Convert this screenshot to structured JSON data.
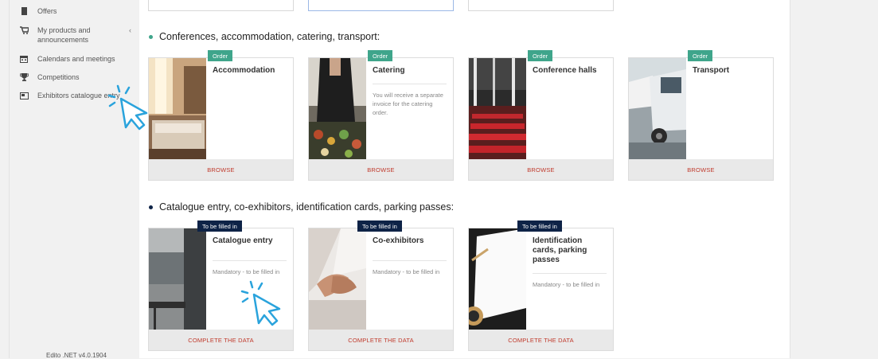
{
  "sidebar": {
    "items": [
      {
        "label": "Offers",
        "icon": "document-icon"
      },
      {
        "label": "My products and announcements",
        "icon": "cart-icon"
      },
      {
        "label": "Calendars and meetings",
        "icon": "calendar-icon"
      },
      {
        "label": "Competitions",
        "icon": "trophy-icon"
      },
      {
        "label": "Exhibitors catalogue entry",
        "icon": "catalogue-icon"
      }
    ],
    "chevron": "‹",
    "version": "Edito .NET v4.0.1904"
  },
  "sections": [
    {
      "title": "Conferences, accommodation, catering, transport:",
      "bullet_color": "#3fa58b",
      "cards": [
        {
          "tag": "Order",
          "title": "Accommodation",
          "desc": "",
          "action": "BROWSE"
        },
        {
          "tag": "Order",
          "title": "Catering",
          "desc": "You will receive a separate invoice for the catering order.",
          "action": "BROWSE"
        },
        {
          "tag": "Order",
          "title": "Conference halls",
          "desc": "",
          "action": "BROWSE"
        },
        {
          "tag": "Order",
          "title": "Transport",
          "desc": "",
          "action": "BROWSE"
        }
      ]
    },
    {
      "title": "Catalogue entry, co-exhibitors, identification cards, parking passes:",
      "bullet_color": "#0e2347",
      "cards": [
        {
          "tag": "To be filled in",
          "title": "Catalogue entry",
          "desc": "Mandatory - to be filled in",
          "action": "COMPLETE THE DATA"
        },
        {
          "tag": "To be filled in",
          "title": "Co-exhibitors",
          "desc": "Mandatory - to be filled in",
          "action": "COMPLETE THE DATA"
        },
        {
          "tag": "To be filled in",
          "title": "Identification cards, parking passes",
          "desc": "Mandatory - to be filled in",
          "action": "COMPLETE THE DATA"
        }
      ]
    }
  ],
  "colors": {
    "order_tag": "#3fa58b",
    "fill_tag": "#0e2347",
    "action_text": "#c0392b",
    "cursor": "#2aa3dc"
  }
}
